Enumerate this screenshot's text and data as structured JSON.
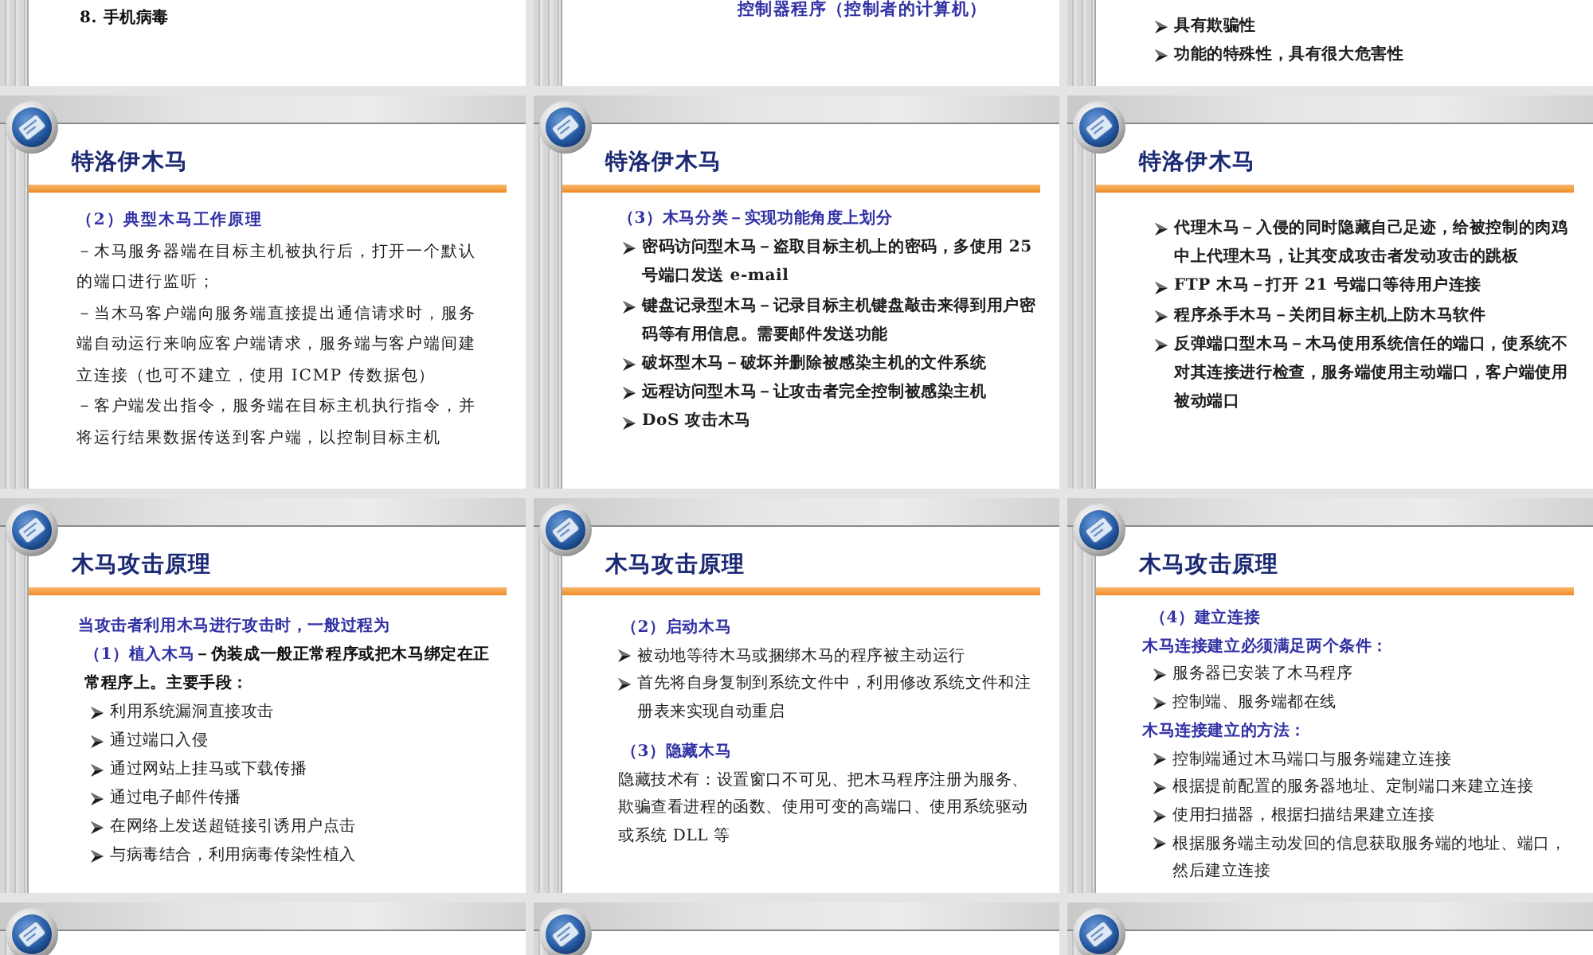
{
  "rows": [
    {
      "slides": [
        {
          "kind": "tail",
          "blocks": [
            {
              "kind": "strong",
              "text": "8. 手机病毒"
            }
          ]
        },
        {
          "kind": "tail",
          "blocks": [
            {
              "kind": "caption",
              "text": "控制器程序（控制者的计算机）"
            }
          ]
        },
        {
          "kind": "tail",
          "blocks": [
            {
              "kind": "bullet",
              "text": "具有欺骗性"
            },
            {
              "kind": "bullet",
              "text": "功能的特殊性，具有很大危害性"
            }
          ]
        }
      ]
    },
    {
      "slides": [
        {
          "kind": "full",
          "title": "特洛伊木马",
          "blocks": [
            {
              "kind": "heading",
              "text": "（2）典型木马工作原理"
            },
            {
              "kind": "text",
              "text": "－木马服务器端在目标主机被执行后，打开一个默认的端口进行监听；"
            },
            {
              "kind": "text",
              "text": "－当木马客户端向服务端直接提出通信请求时，服务端自动运行来响应客户端请求，服务端与客户端间建立连接（也可不建立，使用 ICMP 传数据包）"
            },
            {
              "kind": "text",
              "text": "－客户端发出指令，服务端在目标主机执行指令，并将运行结果数据传送到客户端，以控制目标主机"
            }
          ]
        },
        {
          "kind": "full",
          "title": "特洛伊木马",
          "blocks": [
            {
              "kind": "heading",
              "text": "（3）木马分类－实现功能角度上划分"
            },
            {
              "kind": "bullet",
              "text": "密码访问型木马－盗取目标主机上的密码，多使用 25 号端口发送 e-mail"
            },
            {
              "kind": "bullet",
              "text": "键盘记录型木马－记录目标主机键盘敲击来得到用户密码等有用信息。需要邮件发送功能"
            },
            {
              "kind": "bullet",
              "text": "破坏型木马－破坏并删除被感染主机的文件系统"
            },
            {
              "kind": "bullet",
              "text": "远程访问型木马－让攻击者完全控制被感染主机"
            },
            {
              "kind": "bullet",
              "text": "DoS 攻击木马"
            }
          ]
        },
        {
          "kind": "full",
          "title": "特洛伊木马",
          "blocks": [
            {
              "kind": "bullet",
              "text": "代理木马－入侵的同时隐藏自己足迹，给被控制的肉鸡中上代理木马，让其变成攻击者发动攻击的跳板"
            },
            {
              "kind": "bullet",
              "text": "FTP 木马－打开 21 号端口等待用户连接"
            },
            {
              "kind": "bullet",
              "text": "程序杀手木马－关闭目标主机上防木马软件"
            },
            {
              "kind": "bullet",
              "text": "反弹端口型木马－木马使用系统信任的端口，使系统不对其连接进行检查，服务端使用主动端口，客户端使用被动端口"
            }
          ]
        }
      ]
    },
    {
      "slides": [
        {
          "kind": "full",
          "title": "木马攻击原理",
          "blocks": [
            {
              "kind": "lead",
              "text": "当攻击者利用木马进行攻击时，一般过程为"
            },
            {
              "kind": "labeled",
              "label": "（1）植入木马",
              "text": "－伪装成一般正常程序或把木马绑定在正常程序上。主要手段："
            },
            {
              "kind": "bullet",
              "text": "利用系统漏洞直接攻击"
            },
            {
              "kind": "bullet",
              "text": "通过端口入侵"
            },
            {
              "kind": "bullet",
              "text": "通过网站上挂马或下载传播"
            },
            {
              "kind": "bullet",
              "text": "通过电子邮件传播"
            },
            {
              "kind": "bullet",
              "text": "在网络上发送超链接引诱用户点击"
            },
            {
              "kind": "bullet",
              "text": "与病毒结合，利用病毒传染性植入"
            }
          ]
        },
        {
          "kind": "full",
          "title": "木马攻击原理",
          "blocks": [
            {
              "kind": "heading",
              "text": "（2）启动木马"
            },
            {
              "kind": "bullet",
              "text": "被动地等待木马或捆绑木马的程序被主动运行"
            },
            {
              "kind": "bullet",
              "text": "首先将自身复制到系统文件中，利用修改系统文件和注册表来实现自动重启"
            },
            {
              "kind": "heading",
              "text": "（3）隐藏木马"
            },
            {
              "kind": "text",
              "text": "隐藏技术有：设置窗口不可见、把木马程序注册为服务、欺骗查看进程的函数、使用可变的高端口、使用系统驱动或系统 DLL 等"
            }
          ]
        },
        {
          "kind": "full",
          "title": "木马攻击原理",
          "blocks": [
            {
              "kind": "heading",
              "text": "（4）建立连接"
            },
            {
              "kind": "lead",
              "text": "木马连接建立必须满足两个条件："
            },
            {
              "kind": "bullet",
              "text": "服务器已安装了木马程序"
            },
            {
              "kind": "bullet",
              "text": "控制端、服务端都在线"
            },
            {
              "kind": "lead",
              "text": "木马连接建立的方法："
            },
            {
              "kind": "bullet",
              "text": "控制端通过木马端口与服务端建立连接"
            },
            {
              "kind": "bullet",
              "text": "根据提前配置的服务器地址、定制端口来建立连接"
            },
            {
              "kind": "bullet",
              "text": "使用扫描器，根据扫描结果建立连接"
            },
            {
              "kind": "bullet",
              "text": "根据服务端主动发回的信息获取服务端的地址、端口，然后建立连接"
            }
          ]
        }
      ]
    },
    {
      "slides": [
        {
          "kind": "head"
        },
        {
          "kind": "head"
        },
        {
          "kind": "head"
        }
      ]
    }
  ]
}
